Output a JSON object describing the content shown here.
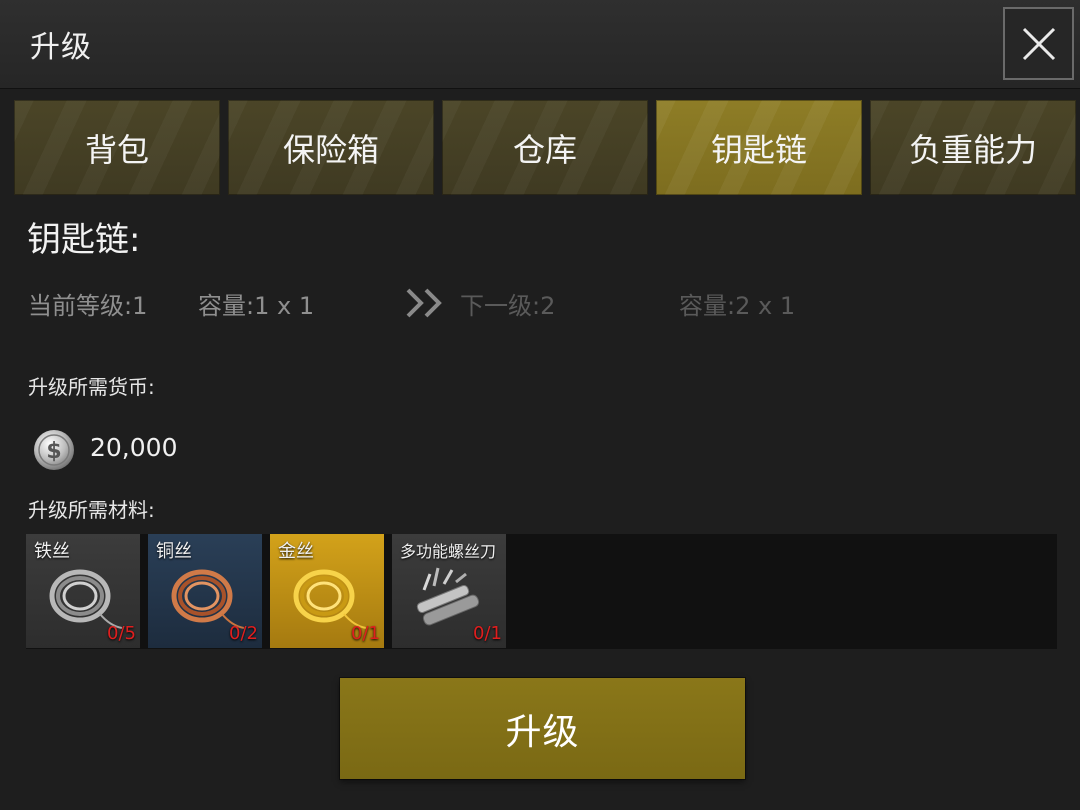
{
  "window": {
    "title": "升级"
  },
  "tabs": [
    {
      "label": "背包",
      "active": false
    },
    {
      "label": "保险箱",
      "active": false
    },
    {
      "label": "仓库",
      "active": false
    },
    {
      "label": "钥匙链",
      "active": true
    },
    {
      "label": "负重能力",
      "active": false
    }
  ],
  "section_title": "钥匙链:",
  "levels": {
    "current": "当前等级:1",
    "current_capacity": "容量:1 x 1",
    "next": "下一级:2",
    "next_capacity": "容量:2 x 1"
  },
  "currency": {
    "label": "升级所需货币:",
    "icon": "silver-coin-icon",
    "amount": "20,000"
  },
  "materials": {
    "label": "升级所需材料:",
    "items": [
      {
        "name": "铁丝",
        "count": "0/5",
        "icon": "iron-wire-icon"
      },
      {
        "name": "铜丝",
        "count": "0/2",
        "icon": "copper-wire-icon"
      },
      {
        "name": "金丝",
        "count": "0/1",
        "icon": "gold-wire-icon"
      },
      {
        "name": "多功能螺丝刀",
        "count": "0/1",
        "icon": "multitool-screwdriver-icon"
      }
    ]
  },
  "upgrade_button": {
    "label": "升级"
  },
  "colors": {
    "tab_active": "#8e7d26",
    "tab_inactive": "#4b4527",
    "button": "#8a7719",
    "missing_count": "#e01e1e"
  }
}
